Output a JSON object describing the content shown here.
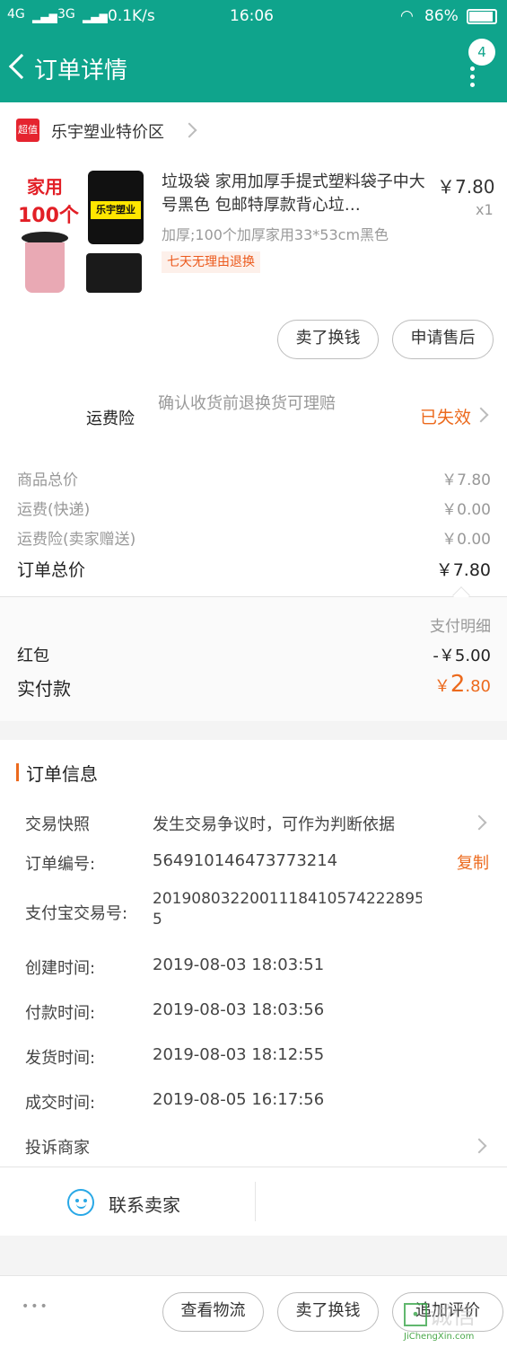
{
  "status_bar": {
    "network_left": "4G",
    "network_mid": "3G",
    "speed": "0.1K/s",
    "time": "16:06",
    "battery": "86%"
  },
  "nav": {
    "title": "订单详情",
    "badge": "4"
  },
  "shop": {
    "badge": "超值",
    "name": "乐宇塑业特价区"
  },
  "product": {
    "image_text_1": "家用",
    "image_text_2": "100个",
    "image_text_3": "乐宇塑业",
    "title": "垃圾袋 家用加厚手提式塑料袋子中大号黑色 包邮特厚款背心垃…",
    "sku": "加厚;100个加厚家用33*53cm黑色",
    "tag": "七天无理由退换",
    "price": "￥7.80",
    "qty": "x1"
  },
  "item_actions": {
    "sell": "卖了换钱",
    "after_sale": "申请售后"
  },
  "freight_insurance": {
    "label": "运费险",
    "desc": "确认收货前退换货可理赔",
    "status": "已失效"
  },
  "summary": {
    "goods_label": "商品总价",
    "goods_value": "￥7.80",
    "shipping_label": "运费(快递)",
    "shipping_value": "￥0.00",
    "insurance_label": "运费险(卖家赠送)",
    "insurance_value": "￥0.00",
    "total_label": "订单总价",
    "total_value": "￥7.80"
  },
  "payment": {
    "detail_label": "支付明细",
    "hongbao_label": "红包",
    "hongbao_value": "-￥5.00",
    "paid_label": "实付款",
    "paid_currency": "￥",
    "paid_int": "2",
    "paid_dec": ".80"
  },
  "order_info": {
    "header": "订单信息",
    "snapshot_label": "交易快照",
    "snapshot_value": "发生交易争议时，可作为判断依据",
    "no_label": "订单编号:",
    "no_value": "564910146473773214",
    "copy": "复制",
    "alipay_label": "支付宝交易号:",
    "alipay_value_1": "2019080322001118410574222895",
    "alipay_value_2": "5",
    "created_label": "创建时间:",
    "created_value": "2019-08-03 18:03:51",
    "paid_label": "付款时间:",
    "paid_value": "2019-08-03 18:03:56",
    "shipped_label": "发货时间:",
    "shipped_value": "2019-08-03 18:12:55",
    "done_label": "成交时间:",
    "done_value": "2019-08-05 16:17:56",
    "complain_label": "投诉商家",
    "contact": "联系卖家"
  },
  "bottom_bar": {
    "more": "•••",
    "logistics": "查看物流",
    "sell": "卖了换钱",
    "review": "追加评价"
  },
  "watermark": {
    "cn": "诚信",
    "en": "JiChengXin.com"
  }
}
